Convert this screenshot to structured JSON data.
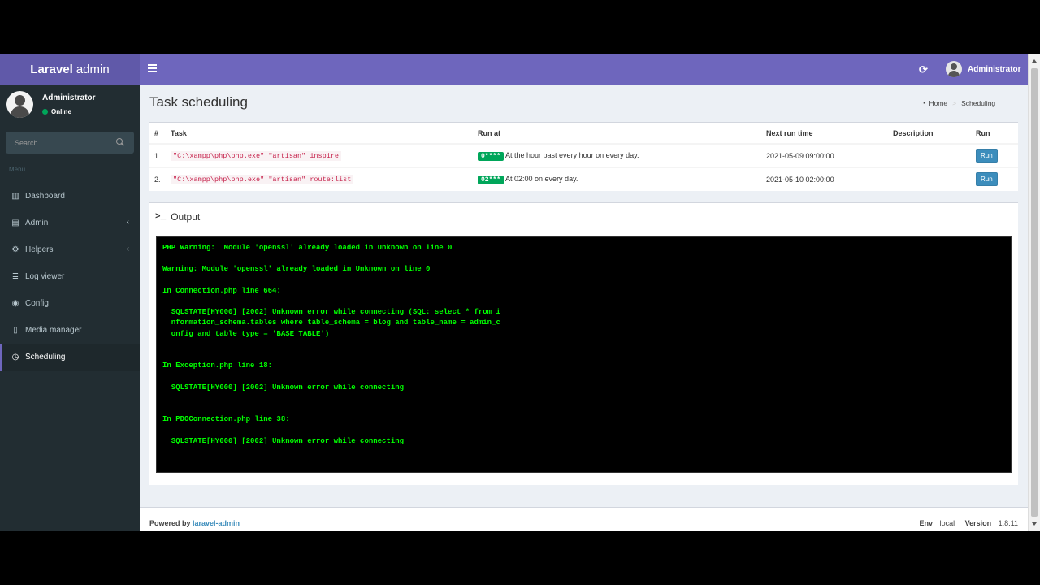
{
  "app": {
    "logo_bold": "Laravel",
    "logo_rest": "admin"
  },
  "navbar": {
    "user_name": "Administrator",
    "refresh_icon": "refresh-icon"
  },
  "sidebar": {
    "user_name": "Administrator",
    "status": "Online",
    "search_placeholder": "Search...",
    "menu_header": "Menu",
    "items": [
      {
        "label": "Dashboard",
        "icon": "bar-chart-icon"
      },
      {
        "label": "Admin",
        "icon": "tasks-icon"
      },
      {
        "label": "Helpers",
        "icon": "gears-icon"
      },
      {
        "label": "Log viewer",
        "icon": "database-icon"
      },
      {
        "label": "Config",
        "icon": "toggle-icon"
      },
      {
        "label": "Media manager",
        "icon": "file-icon"
      },
      {
        "label": "Scheduling",
        "icon": "clock-icon",
        "active": true
      }
    ]
  },
  "page": {
    "title": "Task scheduling",
    "breadcrumb": {
      "home": "Home",
      "current": "Scheduling"
    }
  },
  "table": {
    "headers": [
      "#",
      "Task",
      "Run at",
      "Next run time",
      "Description",
      "Run"
    ],
    "rows": [
      {
        "num": "1.",
        "task": "\"C:\\xampp\\php\\php.exe\" \"artisan\" inspire",
        "cron": "0****",
        "run_at": "At the hour past every hour on every day.",
        "next_run": "2021-05-09 09:00:00",
        "description": "",
        "run_label": "Run"
      },
      {
        "num": "2.",
        "task": "\"C:\\xampp\\php\\php.exe\" \"artisan\" route:list",
        "cron": "02***",
        "run_at": "At 02:00 on every day.",
        "next_run": "2021-05-10 02:00:00",
        "description": "",
        "run_label": "Run"
      }
    ]
  },
  "output": {
    "title": "Output",
    "text": "PHP Warning:  Module 'openssl' already loaded in Unknown on line 0\n\nWarning: Module 'openssl' already loaded in Unknown on line 0\n\nIn Connection.php line 664:\n\n  SQLSTATE[HY000] [2002] Unknown error while connecting (SQL: select * from i\n  nformation_schema.tables where table_schema = blog and table_name = admin_c\n  onfig and table_type = 'BASE TABLE')\n\n\nIn Exception.php line 18:\n\n  SQLSTATE[HY000] [2002] Unknown error while connecting\n\n\nIn PDOConnection.php line 38:\n\n  SQLSTATE[HY000] [2002] Unknown error while connecting"
  },
  "footer": {
    "powered_by": "Powered by",
    "link": "laravel-admin",
    "env_label": "Env",
    "env_value": "local",
    "version_label": "Version",
    "version_value": "1.8.11"
  },
  "colors": {
    "navbar": "#6e66bd",
    "logo": "#6059a9",
    "sidebar": "#222d32",
    "label_green": "#00a65a",
    "button_blue": "#3c8dbc",
    "terminal_text": "#00ff00"
  }
}
